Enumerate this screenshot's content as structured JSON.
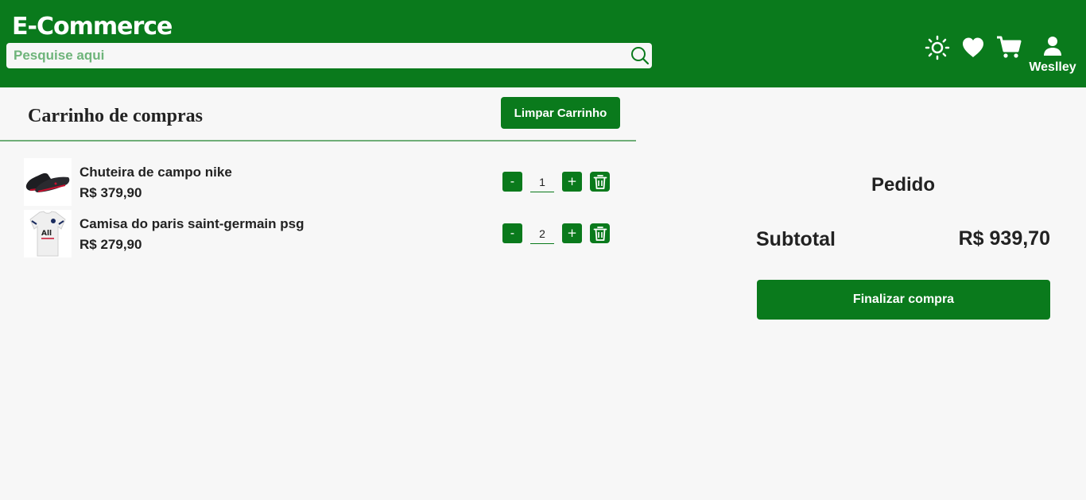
{
  "header": {
    "brand": "E-Commerce",
    "search_placeholder": "Pesquise aqui",
    "search_value": "",
    "icons": [
      "sun-icon",
      "heart-icon",
      "cart-icon",
      "user-icon"
    ],
    "user_name": "Weslley"
  },
  "cart": {
    "title": "Carrinho de compras",
    "clear_label": "Limpar Carrinho",
    "items": [
      {
        "name": "Chuteira de campo nike",
        "price": "R$ 379,90",
        "quantity": "1",
        "decrement_label": "-",
        "increment_label": "+"
      },
      {
        "name": "Camisa do paris saint-germain psg",
        "price": "R$ 279,90",
        "quantity": "2",
        "decrement_label": "-",
        "increment_label": "+"
      }
    ]
  },
  "order": {
    "title": "Pedido",
    "subtotal_label": "Subtotal",
    "subtotal_value": "R$ 939,70",
    "checkout_label": "Finalizar compra"
  },
  "colors": {
    "primary": "#0a7a1c",
    "background": "#f7f7f7",
    "placeholder": "#6eb47a"
  }
}
